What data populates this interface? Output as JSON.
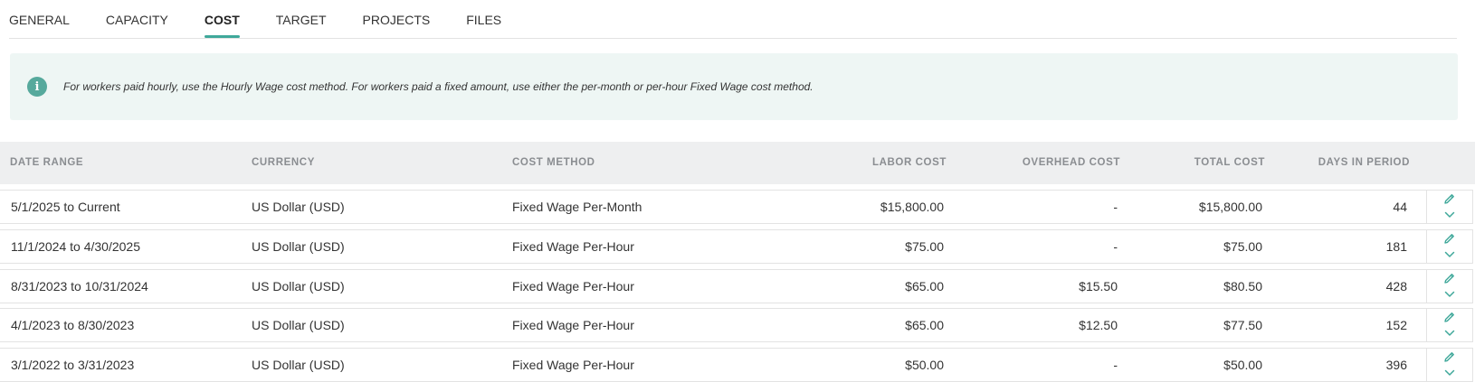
{
  "tabs": [
    {
      "label": "GENERAL",
      "active": false
    },
    {
      "label": "CAPACITY",
      "active": false
    },
    {
      "label": "COST",
      "active": true
    },
    {
      "label": "TARGET",
      "active": false
    },
    {
      "label": "PROJECTS",
      "active": false
    },
    {
      "label": "FILES",
      "active": false
    }
  ],
  "info": {
    "icon": "info-icon",
    "text": "For workers paid hourly, use the Hourly Wage cost method. For workers paid a fixed amount, use either the per-month or per-hour Fixed Wage cost method."
  },
  "table": {
    "headers": {
      "date_range": "DATE RANGE",
      "currency": "CURRENCY",
      "cost_method": "COST METHOD",
      "labor_cost": "LABOR COST",
      "overhead_cost": "OVERHEAD COST",
      "total_cost": "TOTAL COST",
      "days_in_period": "DAYS IN PERIOD"
    },
    "rows": [
      {
        "date_range": "5/1/2025 to Current",
        "currency": "US Dollar (USD)",
        "cost_method": "Fixed Wage Per-Month",
        "labor_cost": "$15,800.00",
        "overhead_cost": "-",
        "total_cost": "$15,800.00",
        "days_in_period": "44"
      },
      {
        "date_range": "11/1/2024 to 4/30/2025",
        "currency": "US Dollar (USD)",
        "cost_method": "Fixed Wage Per-Hour",
        "labor_cost": "$75.00",
        "overhead_cost": "-",
        "total_cost": "$75.00",
        "days_in_period": "181"
      },
      {
        "date_range": "8/31/2023 to 10/31/2024",
        "currency": "US Dollar (USD)",
        "cost_method": "Fixed Wage Per-Hour",
        "labor_cost": "$65.00",
        "overhead_cost": "$15.50",
        "total_cost": "$80.50",
        "days_in_period": "428"
      },
      {
        "date_range": "4/1/2023 to 8/30/2023",
        "currency": "US Dollar (USD)",
        "cost_method": "Fixed Wage Per-Hour",
        "labor_cost": "$65.00",
        "overhead_cost": "$12.50",
        "total_cost": "$77.50",
        "days_in_period": "152"
      },
      {
        "date_range": "3/1/2022 to 3/31/2023",
        "currency": "US Dollar (USD)",
        "cost_method": "Fixed Wage Per-Hour",
        "labor_cost": "$50.00",
        "overhead_cost": "-",
        "total_cost": "$50.00",
        "days_in_period": "396"
      }
    ]
  },
  "icons": {
    "edit": "pencil-icon",
    "expand": "chevron-down-icon"
  },
  "colors": {
    "accent": "#3fa89a",
    "info_bg": "#eef6f4",
    "header_bg": "#eeeff0",
    "header_text": "#8a8d91"
  }
}
